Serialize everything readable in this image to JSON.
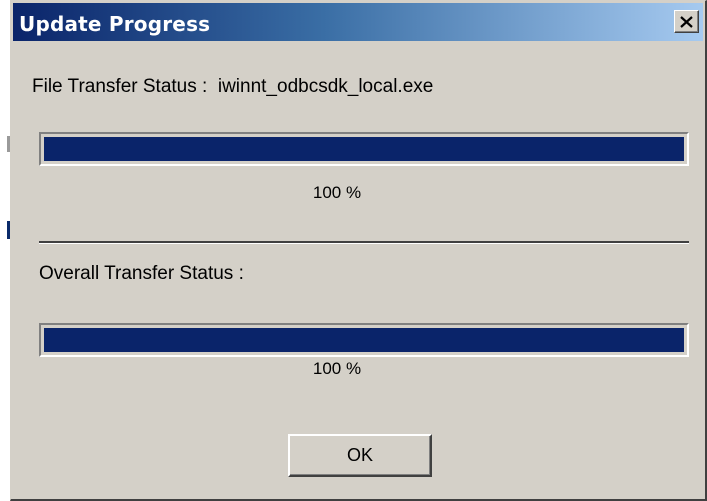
{
  "window": {
    "title": "Update Progress",
    "close_icon": "close-icon",
    "titlebar_color": "#0a246a",
    "background_color": "#d4d0c8"
  },
  "file_transfer": {
    "label": "File Transfer Status :",
    "filename": "iwinnt_odbcsdk_local.exe",
    "progress_percent": 100,
    "progress_text": "100 %"
  },
  "overall_transfer": {
    "label": "Overall Transfer Status :",
    "progress_percent": 100,
    "progress_text": "100 %"
  },
  "buttons": {
    "ok_label": "OK"
  }
}
